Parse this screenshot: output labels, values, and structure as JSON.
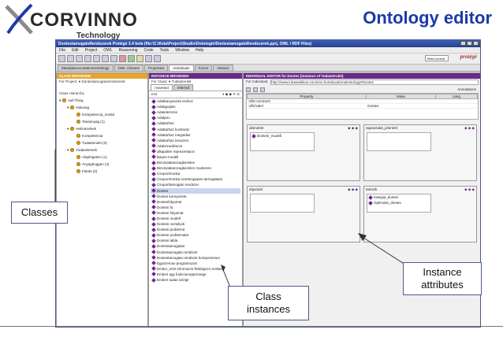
{
  "brand": {
    "name": "CORVINNO",
    "tagline": "Technology Transfer"
  },
  "slide_title": "Ontology editor",
  "window": {
    "title": "DontestamogatoRendszerek Protégé 3.4 beta (file:\\C:\\Kela\\Project\\Studio\\Ontologie\\DontestamogatoRendszerek.pprj, OWL / RDF Files)",
    "menu": [
      "File",
      "Edit",
      "Project",
      "OWL",
      "Reasoning",
      "Code",
      "Tools",
      "Window",
      "Help"
    ],
    "search_value": "Telles kereső",
    "logo": "protégé",
    "tabs": [
      "MetadataAnnotationsOntology",
      "OWL Classes",
      "Properties",
      "Individuals",
      "Forms",
      "Ontoviz"
    ],
    "active_tab": "Individuals"
  },
  "class_browser": {
    "header": "CLASS BROWSER",
    "for_project": "For Project: ● Dontestamogatorendszerek",
    "hierarchy_label": "Class Hierarchy",
    "items": [
      {
        "label": "owl:Thing",
        "level": 0
      },
      {
        "label": "Hatosag",
        "level": 1
      },
      {
        "label": "Kompetencia_modul",
        "level": 2
      },
      {
        "label": "Tanannyag (1)",
        "level": 2
      },
      {
        "label": "Helmazelvek",
        "level": 1
      },
      {
        "label": "Kompetencia",
        "level": 2
      },
      {
        "label": "Tudasterulet (3)",
        "level": 2
      },
      {
        "label": "Tudaselemek",
        "level": 1
      },
      {
        "label": "Alapfogalom (1)",
        "level": 2
      },
      {
        "label": "Anyaghoggen (4)",
        "level": 2
      },
      {
        "label": "Fatola (2)",
        "level": 2
      }
    ]
  },
  "instance_browser": {
    "header": "INSTANCE BROWSER",
    "for_class": "For Class: ● Tudasterulet",
    "tabs": [
      "Asserted",
      "Inferred"
    ],
    "list_label": "Inst",
    "items": [
      "Adatbanyaszati eszkoz",
      "Adatgyujtes",
      "Adatelemzes",
      "Adatjaro",
      "Adattarhaz",
      "Adattarhaz kockazat",
      "Adattarhaz megoldas",
      "Adattarhaz tervezes",
      "Adatvizualizacio",
      "alkapolter reprezentacio",
      "Bayes-modell",
      "Bizonytalanszagkezeles",
      "Bizonytalanszagkezeles modszere",
      "Csoportmunka",
      "Csoportmunka szamitogepes tamogatasa",
      "Csoporttamogato rendszer",
      "Dontes",
      "Dontes kornyezete",
      "Dontesfolyamat",
      "Dontesi fa",
      "Dontesi folyamat",
      "Dontesi modell",
      "Dontesi osztalyok",
      "Dontesi problema",
      "Dontesi problemater",
      "Dontesi tabla",
      "Dontestamogatas",
      "Dontestamogato rendszer",
      "Dontestamogato rendszer komponensei",
      "Egyszerusu programozas",
      "Ember_mint informacio-feldolgozo entitas",
      "Emberi agy funkcionogeszsege",
      "Emberi tudas szintje"
    ]
  },
  "individual_editor": {
    "header": "INDIVIDUAL EDITOR for Dontes   (instance of Tudasterulet)",
    "for_individual": "http://www.intrawebikus.corvinno.hu/educationalontology#Dontes",
    "annotations_label": "Annotations",
    "columns": [
      "Property",
      "Value",
      "Lang"
    ],
    "rows": [
      {
        "property": "rdfs:comment",
        "value": "",
        "lang": ""
      },
      {
        "property": "rdfs:label",
        "value": "Dontes",
        "lang": ""
      }
    ],
    "slots": [
      {
        "label": "alterulete",
        "values": [
          "Dontesi_modell"
        ]
      },
      {
        "label": "tapasztalat_jelentett",
        "values": []
      },
      {
        "label": "elgondol",
        "values": []
      },
      {
        "label": "tartozik",
        "values": [
          "Kategia_dontes",
          "Optimalis_dontes"
        ]
      }
    ]
  },
  "callouts": {
    "classes": "Classes",
    "instances": "Class instances",
    "attributes": "Instance attributes"
  }
}
